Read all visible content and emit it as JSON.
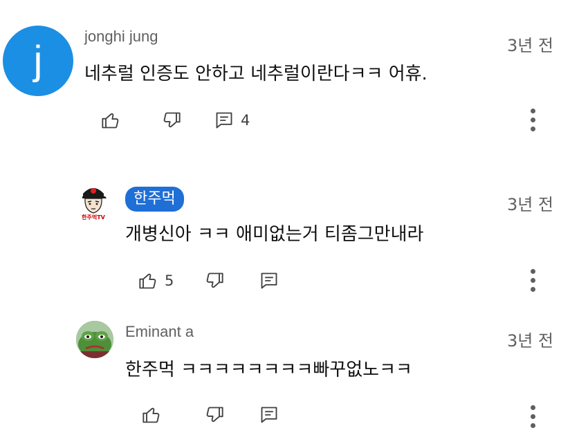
{
  "comments": [
    {
      "avatar_letter": "j",
      "author": "jonghi jung",
      "time": "3년 전",
      "text": "네추럴 인증도 안하고 네추럴이란다ㅋㅋ 어휴.",
      "like_count": "",
      "reply_count": "4"
    },
    {
      "avatar_caption": "한주먹TV",
      "author": "한주먹",
      "time": "3년 전",
      "text": "개병신아 ㅋㅋ 애미없는거 티좀그만내라",
      "like_count": "5",
      "reply_count": ""
    },
    {
      "author": "Eminant a",
      "time": "3년 전",
      "text": "한주먹 ㅋㅋㅋㅋㅋㅋㅋㅋ빠꾸없노ㅋㅋ",
      "like_count": "",
      "reply_count": ""
    }
  ],
  "icons": {
    "like": "thumb-up-icon",
    "dislike": "thumb-down-icon",
    "reply": "reply-icon",
    "more": "more-vert-icon"
  },
  "colors": {
    "avatar_blue": "#1b8fe3",
    "author_chip": "#1f6fd6",
    "secondary_text": "#606060"
  }
}
